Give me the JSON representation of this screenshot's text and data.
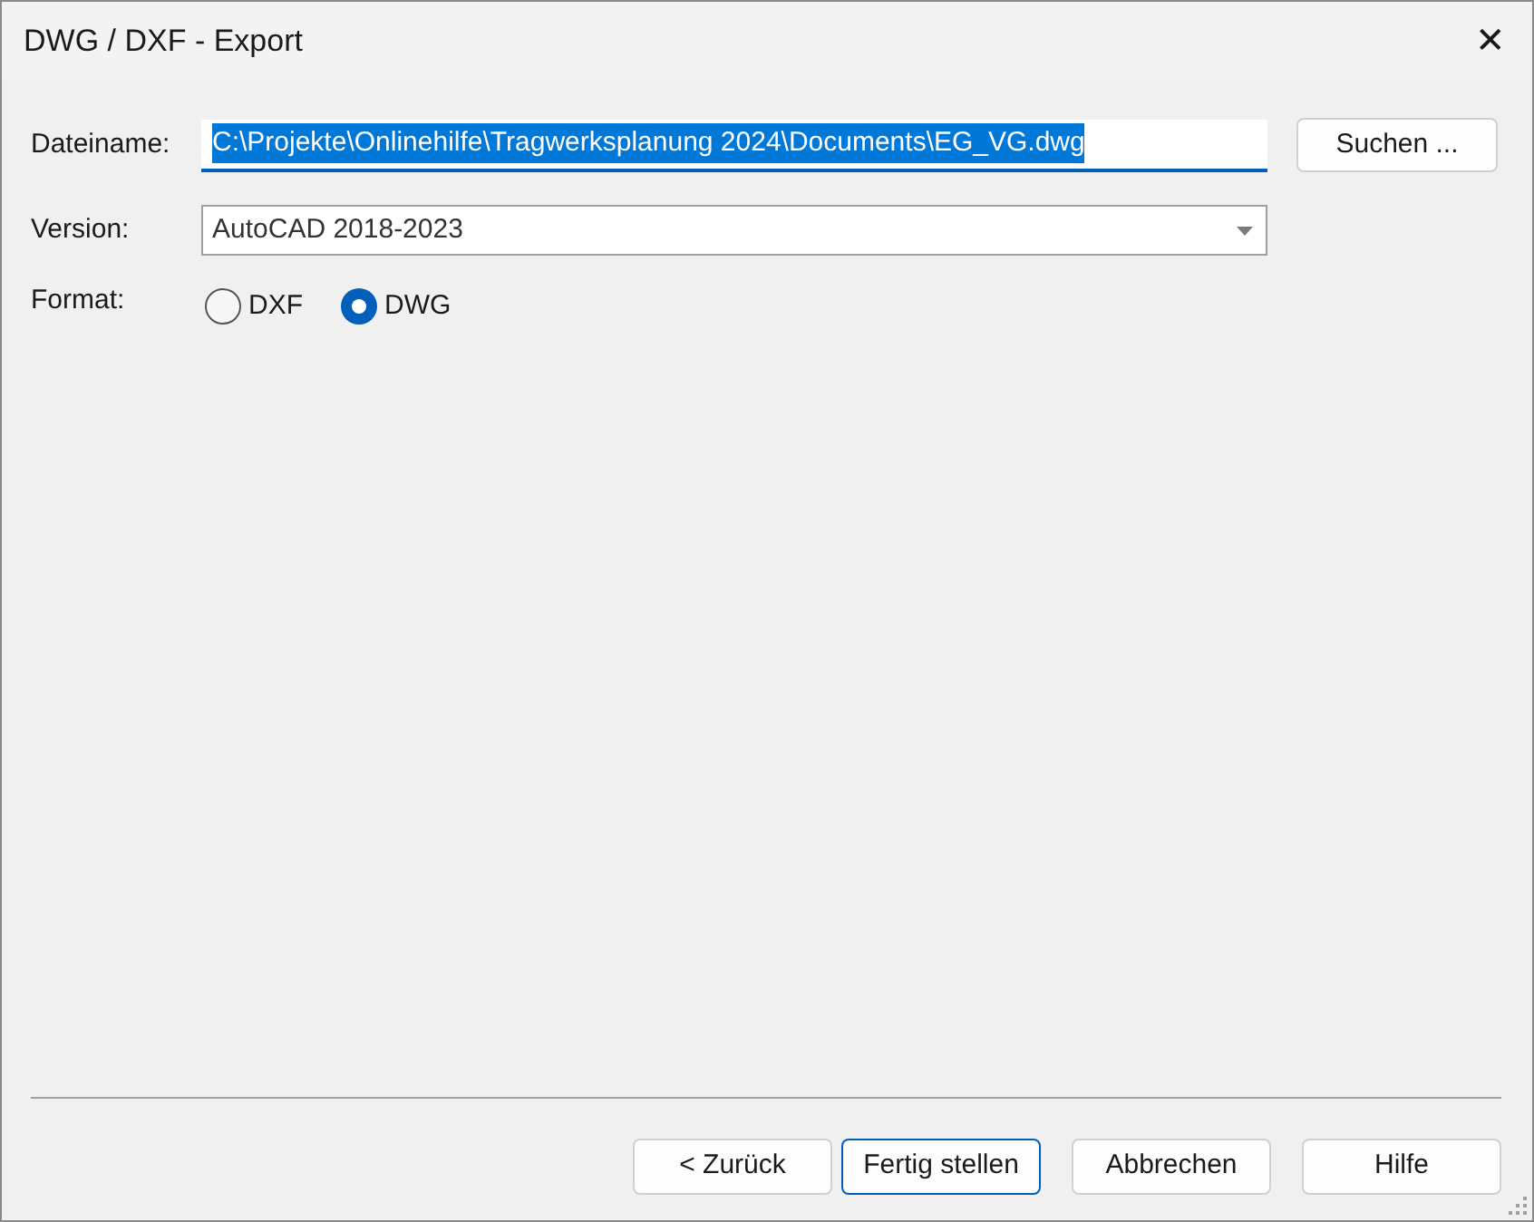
{
  "window": {
    "title": "DWG / DXF - Export",
    "close": "✕"
  },
  "filename": {
    "label": "Dateiname:",
    "value": "C:\\Projekte\\Onlinehilfe\\Tragwerksplanung 2024\\Documents\\EG_VG.dwg",
    "text_selected": true,
    "browse": "Suchen ..."
  },
  "version": {
    "label": "Version:",
    "value": "AutoCAD 2018-2023"
  },
  "format": {
    "label": "Format:",
    "options": [
      {
        "label": "DXF",
        "selected": false
      },
      {
        "label": "DWG",
        "selected": true
      }
    ]
  },
  "buttons": [
    {
      "label": "< Zurück",
      "default": false
    },
    {
      "label": "Fertig stellen",
      "default": true
    },
    {
      "label": "Abbrechen",
      "default": false
    },
    {
      "label": "Hilfe",
      "default": false
    }
  ]
}
